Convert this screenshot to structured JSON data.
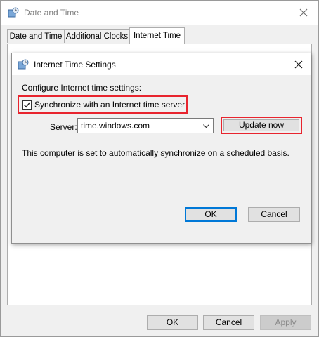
{
  "window": {
    "title": "Date and Time",
    "icon": "clock-globe-icon"
  },
  "tabs": [
    {
      "label": "Date and Time",
      "active": false
    },
    {
      "label": "Additional Clocks",
      "active": false
    },
    {
      "label": "Internet Time",
      "active": true
    }
  ],
  "footer": {
    "ok_label": "OK",
    "cancel_label": "Cancel",
    "apply_label": "Apply"
  },
  "dialog": {
    "title": "Internet Time Settings",
    "configure_label": "Configure Internet time settings:",
    "sync_label": "Synchronize with an Internet time server",
    "sync_checked": true,
    "server_label": "Server:",
    "server_value": "time.windows.com",
    "update_label": "Update now",
    "status_text": "This computer is set to automatically synchronize on a scheduled basis.",
    "ok_label": "OK",
    "cancel_label": "Cancel"
  },
  "colors": {
    "highlight": "#e8242e",
    "default_button": "#0078d7"
  }
}
